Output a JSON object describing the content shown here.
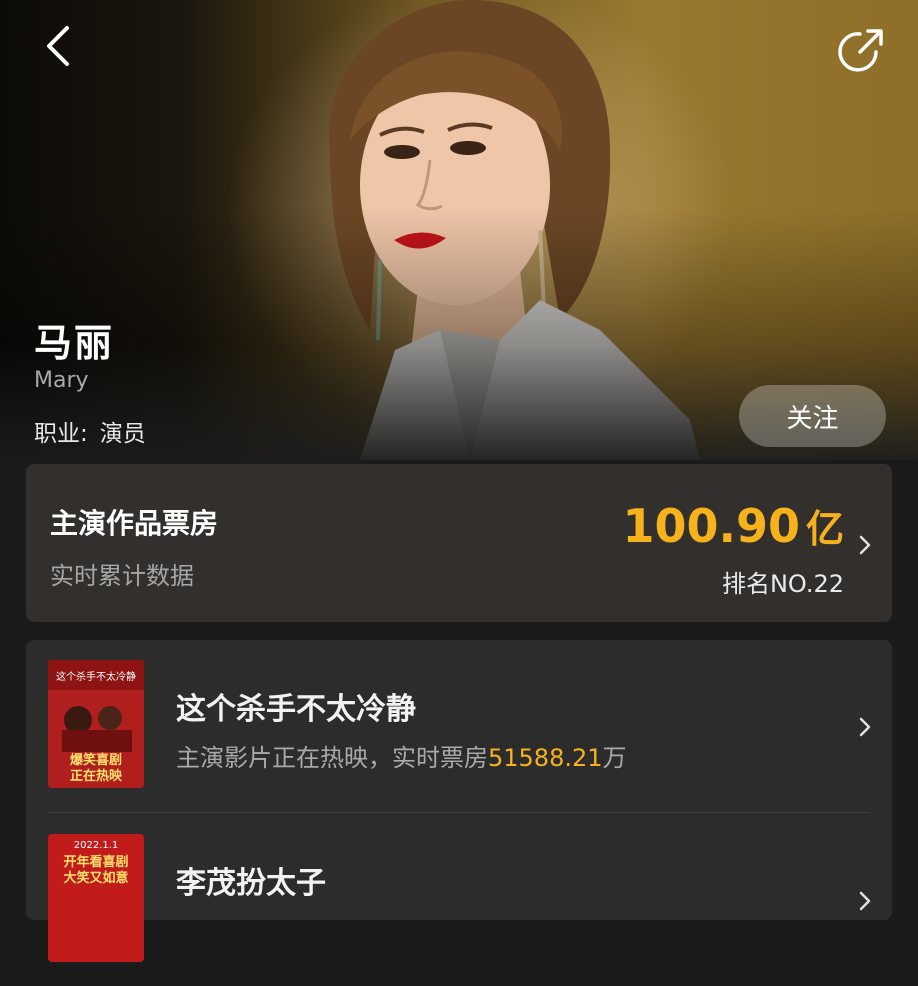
{
  "header": {
    "back_icon": "chevron-left-icon",
    "share_icon": "share-icon"
  },
  "profile": {
    "name": "马丽",
    "en_name": "Mary",
    "job_label": "职业:",
    "job_value": "演员",
    "follow_label": "关注"
  },
  "box_office": {
    "title": "主演作品票房",
    "subtitle": "实时累计数据",
    "amount": "100.90",
    "unit": "亿",
    "rank": "排名NO.22",
    "accent": "#f5b21c"
  },
  "movies": [
    {
      "title": "这个杀手不太冷静",
      "desc_prefix": "主演影片正在热映，实时票房",
      "desc_value": "51588.21",
      "desc_suffix": "万",
      "poster_top": "这个杀手不太冷静",
      "poster_slogan_1": "爆笑喜剧",
      "poster_slogan_2": "正在热映"
    },
    {
      "title": "李茂扮太子",
      "poster_date": "2022.1.1",
      "poster_slogan_1": "开年看喜剧",
      "poster_slogan_2": "大笑又如意"
    }
  ]
}
